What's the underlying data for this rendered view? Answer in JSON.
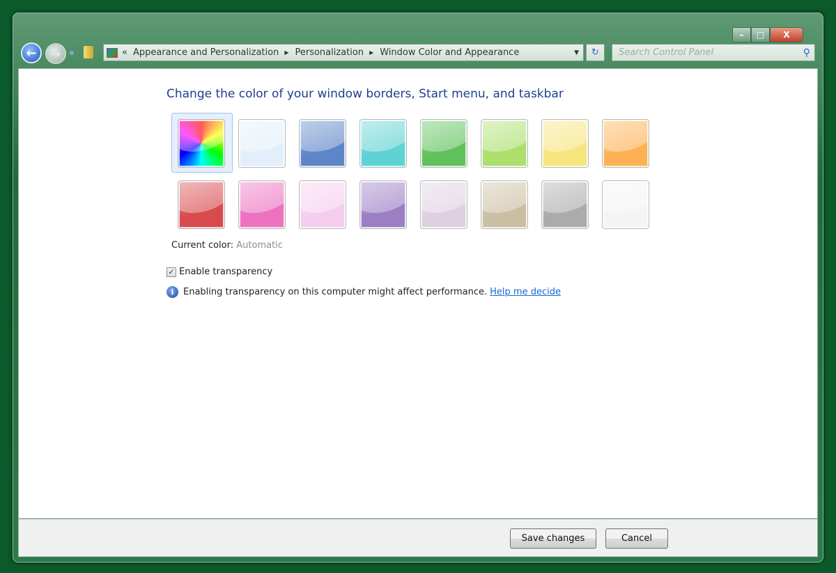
{
  "window": {
    "minimize": "–",
    "maximize": "□",
    "close": "X"
  },
  "nav": {
    "back": "←",
    "forward": "→"
  },
  "address": {
    "overflow": "«",
    "crumbs": [
      "Appearance and Personalization",
      "Personalization",
      "Window Color and Appearance"
    ],
    "refresh": "↻"
  },
  "search": {
    "placeholder": "Search Control Panel",
    "icon": "⚲"
  },
  "main": {
    "title": "Change the color of your window borders, Start menu, and taskbar",
    "swatches": [
      {
        "name": "automatic",
        "color": "rainbow"
      },
      {
        "name": "sky",
        "color": "#e2effb"
      },
      {
        "name": "twilight",
        "color": "#5d86c9"
      },
      {
        "name": "sea",
        "color": "#5fd2d3"
      },
      {
        "name": "leaf",
        "color": "#5fc25c"
      },
      {
        "name": "lime",
        "color": "#addf6f"
      },
      {
        "name": "lemon",
        "color": "#f6e47d"
      },
      {
        "name": "pumpkin",
        "color": "#fdb152"
      },
      {
        "name": "ruby",
        "color": "#d94a4f"
      },
      {
        "name": "fuchsia",
        "color": "#ec72c0"
      },
      {
        "name": "blush",
        "color": "#f6cdee"
      },
      {
        "name": "violet",
        "color": "#9c7ec5"
      },
      {
        "name": "lavender",
        "color": "#ded0e1"
      },
      {
        "name": "taupe",
        "color": "#cbbfa3"
      },
      {
        "name": "chocolate",
        "color": "#ababab"
      },
      {
        "name": "slate",
        "color": "#f4f4f4"
      }
    ],
    "selected_index": 0,
    "current_color_label": "Current color:",
    "current_color_value": "Automatic",
    "transparency_label": "Enable transparency",
    "transparency_checked": true,
    "check_glyph": "✓",
    "info_icon": "i",
    "info_text": "Enabling transparency on this computer might affect performance.",
    "help_link": "Help me decide"
  },
  "footer": {
    "save": "Save changes",
    "cancel": "Cancel"
  }
}
